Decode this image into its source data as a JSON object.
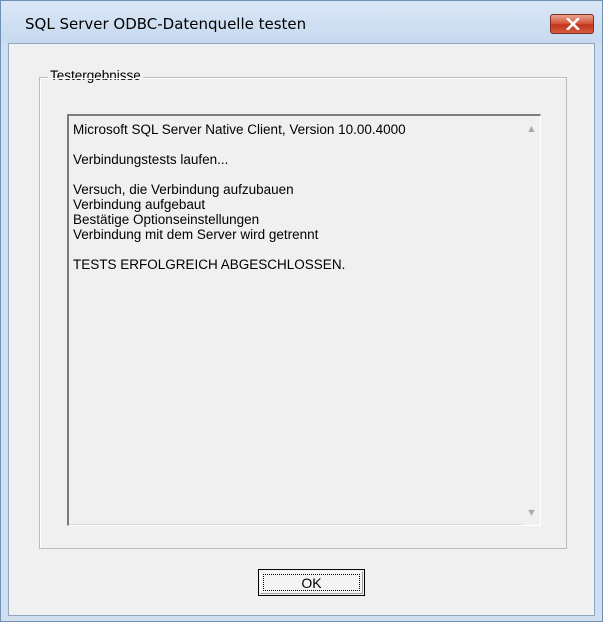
{
  "window": {
    "title": "SQL Server ODBC-Datenquelle testen",
    "close_icon": "close-icon"
  },
  "group": {
    "label": "Testergebnisse"
  },
  "results": {
    "lines": [
      "Microsoft SQL Server Native Client, Version 10.00.4000",
      "",
      "Verbindungstests laufen...",
      "",
      "Versuch, die Verbindung aufzubauen",
      "Verbindung aufgebaut",
      "Bestätige Optionseinstellungen",
      "Verbindung mit dem Server wird getrennt",
      "",
      "TESTS ERFOLGREICH ABGESCHLOSSEN."
    ]
  },
  "buttons": {
    "ok_label": "OK"
  },
  "colors": {
    "titlebar": "#c6d9ef",
    "close_button": "#c2351c",
    "client_background": "#f0f0f0"
  }
}
